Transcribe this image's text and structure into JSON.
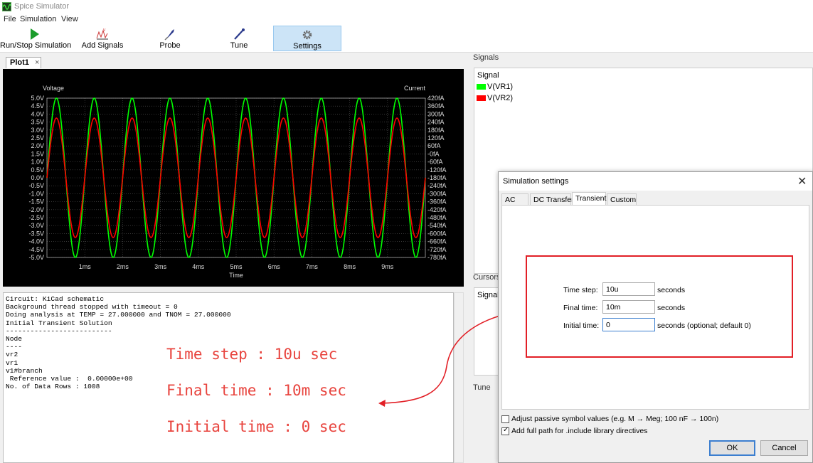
{
  "window": {
    "title": "Spice Simulator"
  },
  "menu": [
    "File",
    "Simulation",
    "View"
  ],
  "toolbar": {
    "run": "Run/Stop Simulation",
    "add_signals": "Add Signals",
    "probe": "Probe",
    "tune": "Tune",
    "settings": "Settings"
  },
  "plot": {
    "tab": "Plot1",
    "left_axis_label": "Voltage",
    "right_axis_label": "Current",
    "x_axis_label": "Time"
  },
  "chart_data": {
    "type": "line",
    "background": "#000000",
    "xlabel": "Time",
    "ylabel_left": "Voltage",
    "ylabel_right": "Current",
    "x_ticks": [
      "1ms",
      "2ms",
      "3ms",
      "4ms",
      "5ms",
      "6ms",
      "7ms",
      "8ms",
      "9ms"
    ],
    "xlim": [
      0,
      10
    ],
    "y_left_ticks": [
      "5.0V",
      "4.5V",
      "4.0V",
      "3.5V",
      "3.0V",
      "2.5V",
      "2.0V",
      "1.5V",
      "1.0V",
      "0.5V",
      "0.0V",
      "-0.5V",
      "-1.0V",
      "-1.5V",
      "-2.0V",
      "-2.5V",
      "-3.0V",
      "-3.5V",
      "-4.0V",
      "-4.5V",
      "-5.0V"
    ],
    "y_right_ticks": [
      "420fA",
      "360fA",
      "300fA",
      "240fA",
      "180fA",
      "120fA",
      "60fA",
      "-0fA",
      "-60fA",
      "-120fA",
      "-180fA",
      "-240fA",
      "-300fA",
      "-360fA",
      "-420fA",
      "-480fA",
      "-540fA",
      "-600fA",
      "-660fA",
      "-720fA",
      "-780fA"
    ],
    "ylim": [
      -5,
      5
    ],
    "grid": true,
    "series": [
      {
        "name": "V(VR1)",
        "color": "#00ff00",
        "amplitude": 5.0,
        "cycles": 10
      },
      {
        "name": "V(VR2)",
        "color": "#ff0000",
        "amplitude": 3.75,
        "cycles": 10
      }
    ]
  },
  "console": {
    "lines": [
      "Circuit: KiCad schematic",
      "Background thread stopped with timeout = 0",
      "Doing analysis at TEMP = 27.000000 and TNOM = 27.000000",
      "Initial Transient Solution",
      "--------------------------",
      "Node",
      "----",
      "vr2",
      "vr1",
      "v1#branch",
      " Reference value :  0.00000e+00",
      "No. of Data Rows : 1008"
    ]
  },
  "annotations": {
    "line1": "Time step : 10u sec",
    "line2": "Final time : 10m sec",
    "line3": "Initial time : 0 sec",
    "color": "#e8443e"
  },
  "right_panel": {
    "signals_label": "Signals",
    "signals_header": "Signal",
    "signals": [
      {
        "name": "V(VR1)",
        "color": "#00ff00"
      },
      {
        "name": "V(VR2)",
        "color": "#ff0000"
      }
    ],
    "cursors_label": "Cursors",
    "cursors_header": "Signal",
    "tune_label": "Tune"
  },
  "dialog": {
    "title": "Simulation settings",
    "tabs": [
      "AC",
      "DC Transfer",
      "Transient",
      "Custom"
    ],
    "selected_tab": "Transient",
    "fields": [
      {
        "label": "Time step:",
        "value": "10u",
        "unit": "seconds"
      },
      {
        "label": "Final time:",
        "value": "10m",
        "unit": "seconds"
      },
      {
        "label": "Initial time:",
        "value": "0",
        "unit": "seconds",
        "note": "(optional; default 0)"
      }
    ],
    "checkbox_adjust": "Adjust passive symbol values (e.g. M → Meg; 100 nF → 100n)",
    "checkbox_adjust_checked": false,
    "checkbox_fullpath": "Add full path for .include library directives",
    "checkbox_fullpath_checked": true,
    "ok": "OK",
    "cancel": "Cancel"
  }
}
